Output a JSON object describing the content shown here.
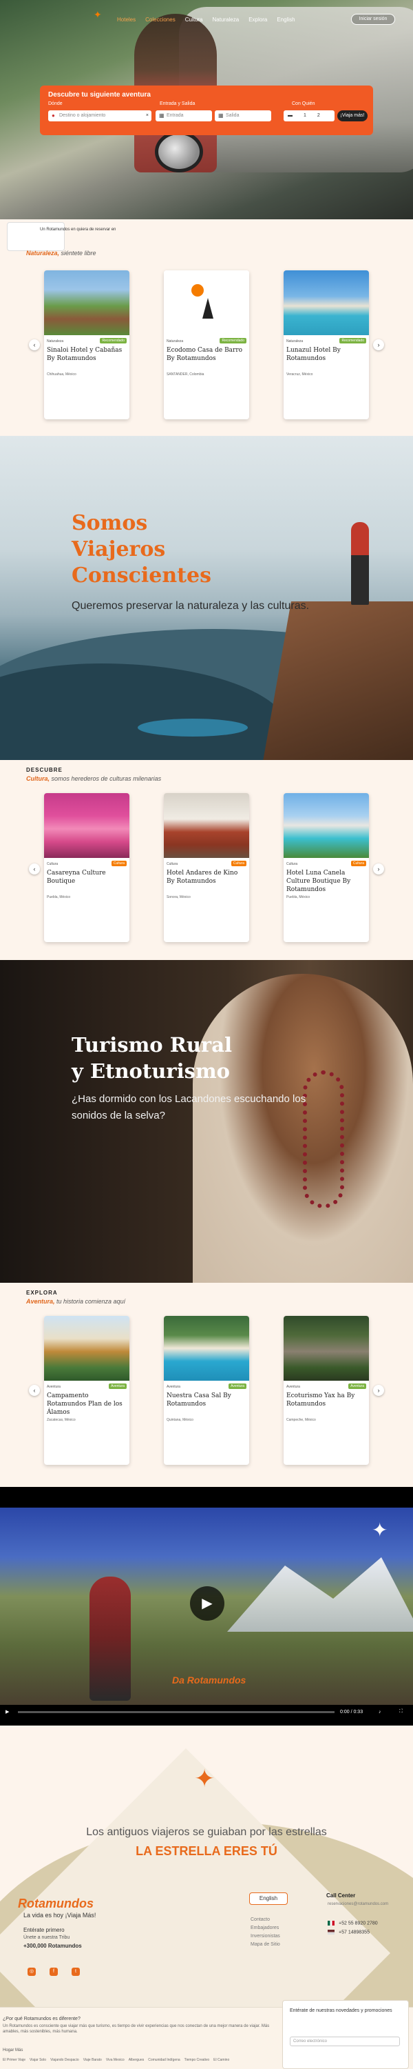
{
  "nav": {
    "links": [
      "Hoteles",
      "Colecciones",
      "Cultura",
      "Naturaleza",
      "Explora",
      "English"
    ],
    "login": "Iniciar sesión"
  },
  "search": {
    "title": "Descubre tu siguiente aventura",
    "labels": [
      "Dónde",
      "Entrada y Salida",
      "Con Quién"
    ],
    "destination_placeholder": "Destino o alojamiento",
    "checkin_placeholder": "Entrada",
    "checkout_placeholder": "Salida",
    "guests_adults": "1",
    "guests_kids": "2",
    "button": "¡Viaja más!"
  },
  "discount_text": "Un Rotamundos en quiera de reservar en",
  "nature": {
    "label": "",
    "sub_bold": "Naturaleza,",
    "sub_rest": " siéntete libre",
    "cards": [
      {
        "cat": "Naturaleza",
        "badge": "Recomendado",
        "title": "Sinaloi Hotel y Cabañas By Rotamundos",
        "loc": "Chihuahua, México"
      },
      {
        "cat": "Naturaleza",
        "badge": "Recomendado",
        "title": "Ecodomo Casa de Barro By Rotamundos",
        "loc": "SANTANDER, Colombia"
      },
      {
        "cat": "Naturaleza",
        "badge": "Recomendado",
        "title": "Lunazul Hotel By Rotamundos",
        "loc": "Veracruz, México"
      }
    ]
  },
  "mountain_banner": {
    "title_lines": [
      "Somos",
      "Viajeros",
      "Conscientes"
    ],
    "subtitle": "Queremos preservar la naturaleza y las culturas."
  },
  "culture": {
    "label": "DESCUBRE",
    "sub_bold": "Cultura,",
    "sub_rest": " somos herederos de culturas milenarias",
    "cards": [
      {
        "cat": "Cultura",
        "badge": "Cultura",
        "title": "Casareyna Culture Boutique",
        "loc": "Puebla, México"
      },
      {
        "cat": "Cultura",
        "badge": "Cultura",
        "title": "Hotel Andares de Kino By Rotamundos",
        "loc": "Sonora, México"
      },
      {
        "cat": "Cultura",
        "badge": "Cultura",
        "title": "Hotel Luna Canela Culture Boutique By Rotamundos",
        "loc": "Puebla, México"
      }
    ]
  },
  "rural_banner": {
    "title_lines": [
      "Turismo Rural",
      "y Etnoturismo"
    ],
    "subtitle": "¿Has dormido con los Lacandones escuchando los sonidos de la selva?"
  },
  "explore": {
    "label": "EXPLORA",
    "sub_bold": "Aventura,",
    "sub_rest": " tu historia comienza aquí",
    "cards": [
      {
        "cat": "Aventura",
        "badge": "Aventura",
        "title": "Campamento Rotamundos Plan de los Álamos",
        "loc": "Zacatecas, México"
      },
      {
        "cat": "Aventura",
        "badge": "Aventura",
        "title": "Nuestra Casa Sal By Rotamundos",
        "loc": "Quintana, México"
      },
      {
        "cat": "Aventura",
        "badge": "Aventura",
        "title": "Ecoturismo Yax ha By Rotamundos",
        "loc": "Campeche, México"
      }
    ]
  },
  "video": {
    "watermark": "Da Rotamundos",
    "time": "0:00 / 0:33"
  },
  "star_section": {
    "line1": "Los antiguos viajeros se guiaban por las estrellas",
    "line2": "LA ESTRELLA ERES TÚ"
  },
  "footer": {
    "logo": "Rotamundos",
    "tagline": "La vida es hoy ¡Viaja Más!",
    "join_title": "Entérate primero",
    "join_sub": "Únete a nuestra Tribu",
    "join_count": "+300,000 Rotamundos",
    "lang": "English",
    "links": [
      "Contacto",
      "Embajadores",
      "Inversionistas",
      "Mapa de Sitio"
    ],
    "call_center": "Call Center",
    "email": "reservaciones@rotamundos.com",
    "phones": [
      "+52 55 8920 2780",
      "+57 14898355"
    ],
    "social_icons": [
      "instagram-icon",
      "facebook-icon",
      "twitter-icon"
    ],
    "why_q": "¿Por qué Rotamundos es diferente?",
    "why_a": "Un Rotamundos es consciente que viajar más que turismo, es tiempo de vivir experiencias que nos conectan de una mejor manera de viajar. Más amables, más sostenibles, más humana.",
    "hogar": "Hogar Más",
    "bottom_links": [
      "El Primer Viaje",
      "Viajar Solo",
      "Viajando Despacio",
      "Viaje Barato",
      "Viva Mexico",
      "Albergues",
      "Comunidad Indígena",
      "Tiempo Creativo",
      "El Camino"
    ],
    "newsletter": "Entérate de nuestras novedades y promociones",
    "newsletter_placeholder": "Correo electrónico"
  },
  "colors": {
    "accent": "#e86a1c",
    "search_bg": "#f15a24",
    "badge_green": "#7cb342",
    "badge_orange": "#f57c00"
  }
}
